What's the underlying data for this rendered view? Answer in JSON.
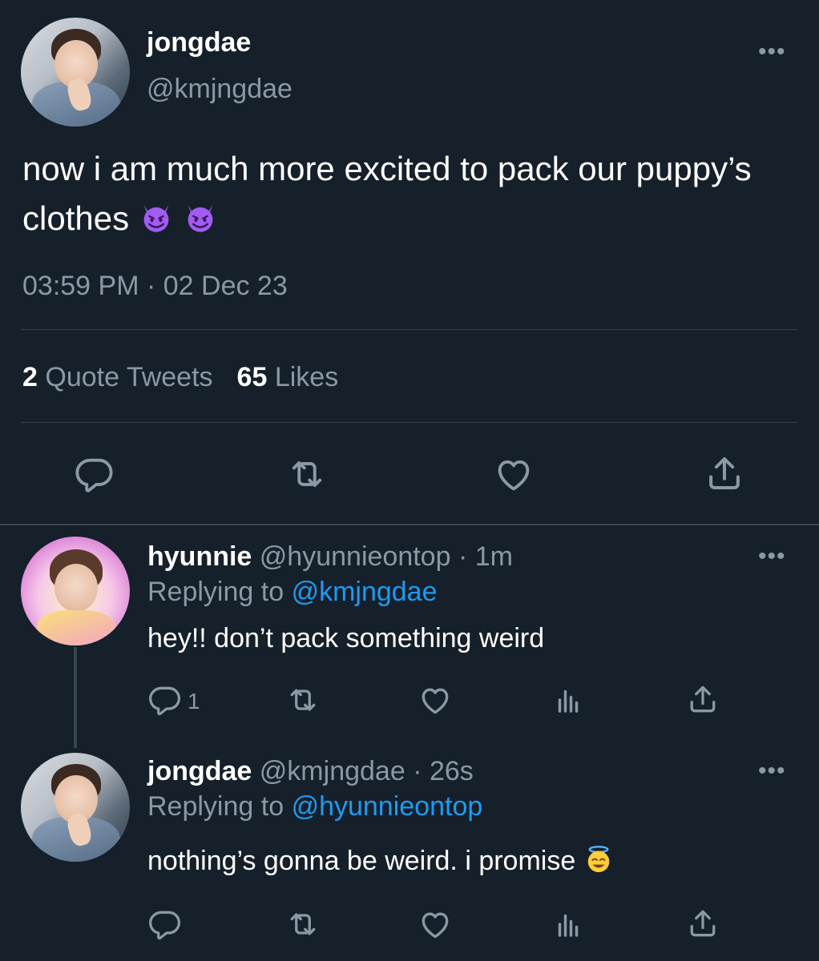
{
  "main_tweet": {
    "author_name": "jongdae",
    "author_handle": "@kmjngdae",
    "text": "now i am much more excited to pack our puppy’s clothes",
    "emojis": [
      "smiling-devil-emoji",
      "smiling-devil-emoji"
    ],
    "timestamp": "03:59 PM · 02 Dec 23",
    "quote_tweets_count": "2",
    "quote_tweets_label": "Quote Tweets",
    "likes_count": "65",
    "likes_label": "Likes",
    "more_label": "•••"
  },
  "replies": [
    {
      "author_name": "hyunnie",
      "author_handle": "@hyunnieontop",
      "time": "· 1m",
      "replying_label": "Replying to",
      "replying_to": "@kmjngdae",
      "text": "hey!! don’t pack something weird",
      "reply_count": "1",
      "more_label": "•••"
    },
    {
      "author_name": "jongdae",
      "author_handle": "@kmjngdae",
      "time": "· 26s",
      "replying_label": "Replying to",
      "replying_to": "@hyunnieontop",
      "text": "nothing’s gonna be weird. i promise",
      "emoji": "halo-smile-emoji",
      "more_label": "•••"
    }
  ],
  "icons": [
    "reply-icon",
    "retweet-icon",
    "like-icon",
    "share-icon",
    "analytics-icon",
    "more-icon"
  ],
  "colors": {
    "background": "#15202b",
    "secondary_text": "#8b98a5",
    "link": "#1d9bf0",
    "divider": "#38444d"
  }
}
